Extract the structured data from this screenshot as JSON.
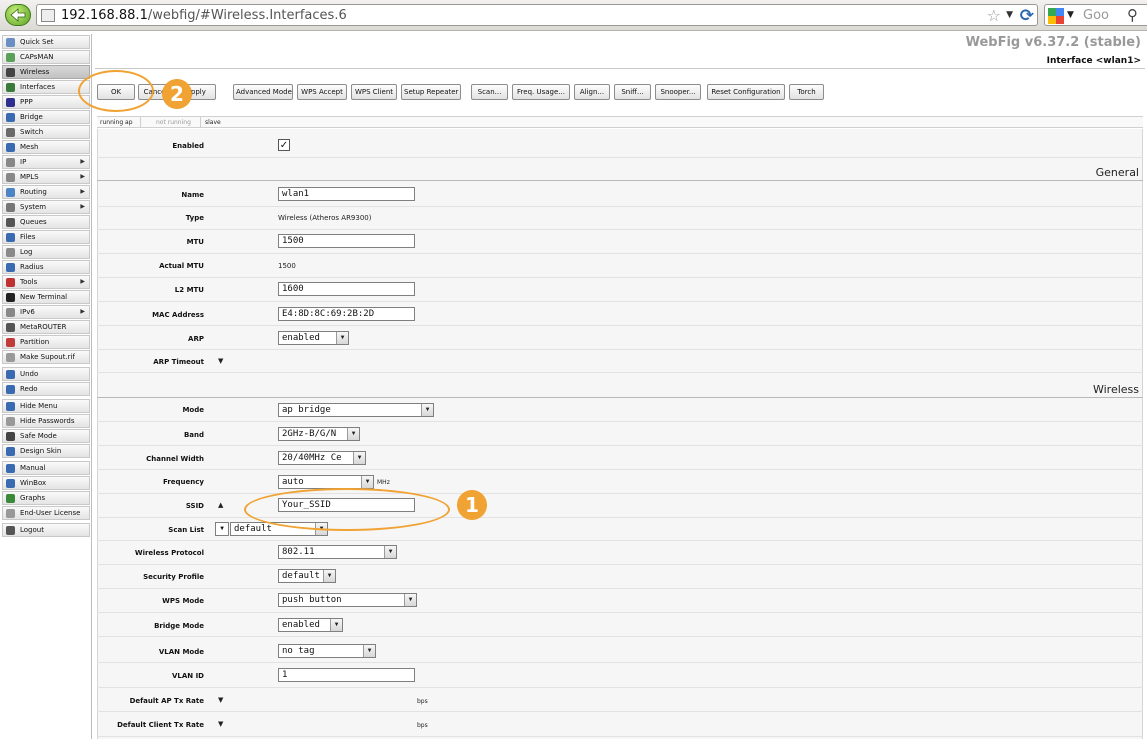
{
  "browser": {
    "url_host": "192.168.88.1",
    "url_path": "/webfig/#Wireless.Interfaces.6",
    "search_placeholder": "Goo"
  },
  "app": {
    "version": "WebFig v6.37.2 (stable)",
    "panel_title": "Interface <wlan1>"
  },
  "sidebar": {
    "items": [
      {
        "label": "Quick Set",
        "icon": "quickset-icon",
        "color": "#6a8fc2"
      },
      {
        "label": "CAPsMAN",
        "icon": "capsman-icon",
        "color": "#5aa05a"
      },
      {
        "label": "Wireless",
        "icon": "wireless-icon",
        "color": "#444444",
        "active": true
      },
      {
        "label": "Interfaces",
        "icon": "interfaces-icon",
        "color": "#3a7a3a"
      },
      {
        "label": "PPP",
        "icon": "ppp-icon",
        "color": "#2f2f8f"
      },
      {
        "label": "Bridge",
        "icon": "bridge-icon",
        "color": "#3a6ab0"
      },
      {
        "label": "Switch",
        "icon": "switch-icon",
        "color": "#6a6a6a"
      },
      {
        "label": "Mesh",
        "icon": "mesh-icon",
        "color": "#3a6ab0"
      },
      {
        "label": "IP",
        "icon": "ip-icon",
        "color": "#888888",
        "arrow": "▶"
      },
      {
        "label": "MPLS",
        "icon": "mpls-icon",
        "color": "#888888",
        "arrow": "▶"
      },
      {
        "label": "Routing",
        "icon": "routing-icon",
        "color": "#4d84c4",
        "arrow": "▶"
      },
      {
        "label": "System",
        "icon": "system-icon",
        "color": "#777777",
        "arrow": "▶"
      },
      {
        "label": "Queues",
        "icon": "queues-icon",
        "color": "#555555"
      },
      {
        "label": "Files",
        "icon": "files-icon",
        "color": "#3a6ab0"
      },
      {
        "label": "Log",
        "icon": "log-icon",
        "color": "#8a8a8a"
      },
      {
        "label": "Radius",
        "icon": "radius-icon",
        "color": "#3a6ab0"
      },
      {
        "label": "Tools",
        "icon": "tools-icon",
        "color": "#c03030",
        "arrow": "▶"
      },
      {
        "label": "New Terminal",
        "icon": "terminal-icon",
        "color": "#222222"
      },
      {
        "label": "IPv6",
        "icon": "ipv6-icon",
        "color": "#888888",
        "arrow": "▶"
      },
      {
        "label": "MetaROUTER",
        "icon": "metarouter-icon",
        "color": "#555555"
      },
      {
        "label": "Partition",
        "icon": "partition-icon",
        "color": "#c23b3b"
      },
      {
        "label": "Make Supout.rif",
        "icon": "supout-icon",
        "color": "#999999"
      },
      {
        "label": "Undo",
        "icon": "undo-icon",
        "color": "#3a6ab0"
      },
      {
        "label": "Redo",
        "icon": "redo-icon",
        "color": "#3a6ab0"
      },
      {
        "label": "Hide Menu",
        "icon": "hide-menu-icon",
        "color": "#3a6ab0"
      },
      {
        "label": "Hide Passwords",
        "icon": "hide-passwords-icon",
        "color": "#999999"
      },
      {
        "label": "Safe Mode",
        "icon": "safe-mode-icon",
        "color": "#444444"
      },
      {
        "label": "Design Skin",
        "icon": "design-skin-icon",
        "color": "#3a6ab0"
      },
      {
        "label": "Manual",
        "icon": "manual-icon",
        "color": "#3a6ab0"
      },
      {
        "label": "WinBox",
        "icon": "winbox-icon",
        "color": "#3a6ab0"
      },
      {
        "label": "Graphs",
        "icon": "graphs-icon",
        "color": "#3a8a3a"
      },
      {
        "label": "End-User License",
        "icon": "license-icon",
        "color": "#999999"
      },
      {
        "label": "Logout",
        "icon": "logout-icon",
        "color": "#555555"
      }
    ]
  },
  "toolbar": {
    "ok": "OK",
    "cancel": "Cancel",
    "apply": "Apply",
    "advanced_mode": "Advanced Mode",
    "wps_accept": "WPS Accept",
    "wps_client": "WPS Client",
    "setup_repeater": "Setup Repeater",
    "scan": "Scan...",
    "freq_usage": "Freq. Usage...",
    "align": "Align...",
    "sniff": "Sniff...",
    "snooper": "Snooper...",
    "reset_configuration": "Reset Configuration",
    "torch": "Torch"
  },
  "status": {
    "running": "running ap",
    "not_running": "not running",
    "slave": "slave"
  },
  "sections": {
    "general": "General",
    "wireless": "Wireless"
  },
  "form": {
    "enabled": {
      "label": "Enabled",
      "value": "✓"
    },
    "name": {
      "label": "Name",
      "value": "wlan1"
    },
    "type": {
      "label": "Type",
      "value": "Wireless (Atheros AR9300)"
    },
    "mtu": {
      "label": "MTU",
      "value": "1500"
    },
    "actual_mtu": {
      "label": "Actual MTU",
      "value": "1500"
    },
    "l2_mtu": {
      "label": "L2 MTU",
      "value": "1600"
    },
    "mac_address": {
      "label": "MAC Address",
      "value": "E4:8D:8C:69:2B:2D"
    },
    "arp": {
      "label": "ARP",
      "value": "enabled"
    },
    "arp_timeout": {
      "label": "ARP Timeout"
    },
    "mode": {
      "label": "Mode",
      "value": "ap bridge"
    },
    "band": {
      "label": "Band",
      "value": "2GHz-B/G/N"
    },
    "channel_width": {
      "label": "Channel Width",
      "value": "20/40MHz Ce"
    },
    "frequency": {
      "label": "Frequency",
      "value": "auto",
      "unit": "MHz"
    },
    "ssid": {
      "label": "SSID",
      "value": "Your_SSID"
    },
    "scan_list": {
      "label": "Scan List",
      "value": "default"
    },
    "wireless_protocol": {
      "label": "Wireless Protocol",
      "value": "802.11"
    },
    "security_profile": {
      "label": "Security Profile",
      "value": "default"
    },
    "wps_mode": {
      "label": "WPS Mode",
      "value": "push button"
    },
    "bridge_mode": {
      "label": "Bridge Mode",
      "value": "enabled"
    },
    "vlan_mode": {
      "label": "VLAN Mode",
      "value": "no tag"
    },
    "vlan_id": {
      "label": "VLAN ID",
      "value": "1"
    },
    "default_ap_tx_rate": {
      "label": "Default AP Tx Rate",
      "unit": "bps"
    },
    "default_client_tx_rate": {
      "label": "Default Client Tx Rate",
      "unit": "bps"
    }
  },
  "annotations": {
    "step1": "1",
    "step2": "2",
    "color": "#f0a232"
  }
}
